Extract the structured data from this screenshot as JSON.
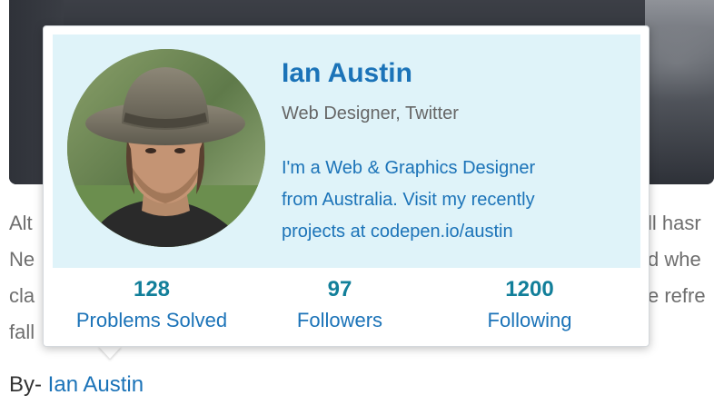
{
  "article": {
    "lines": [
      {
        "left": "Alt",
        "right": "ll hasr"
      },
      {
        "left": "Ne",
        "right": "d whe"
      },
      {
        "left": "cla",
        "right": "e refre"
      },
      {
        "left": "fall",
        "right": ""
      }
    ],
    "byline_prefix": "By-",
    "byline_author": "Ian Austin"
  },
  "profile_card": {
    "name": "Ian Austin",
    "role": "Web Designer, Twitter",
    "bio_lines": [
      "I'm a Web & Graphics Designer",
      "from Australia. Visit my recently",
      "projects at codepen.io/austin"
    ],
    "stats": {
      "problems_solved": {
        "value": "128",
        "label": "Problems Solved"
      },
      "followers": {
        "value": "97",
        "label": "Followers"
      },
      "following": {
        "value": "1200",
        "label": "Following"
      }
    }
  },
  "colors": {
    "accent_blue": "#1b73b8",
    "stat_teal": "#127f9a",
    "header_bg": "#dff3f9"
  }
}
